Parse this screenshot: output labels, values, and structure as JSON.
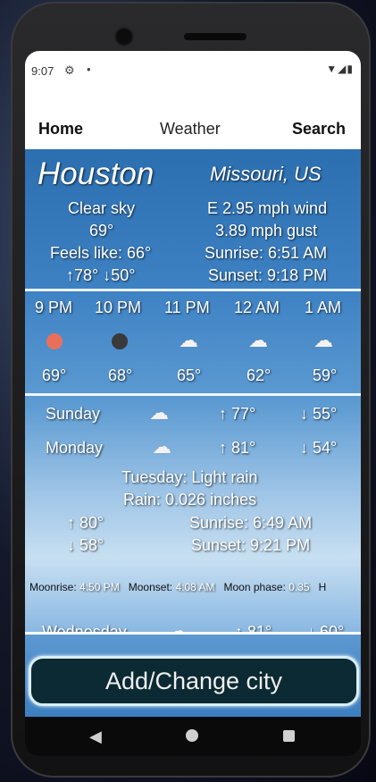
{
  "status": {
    "time": "9:07"
  },
  "nav": {
    "home": "Home",
    "weather": "Weather",
    "search": "Search"
  },
  "current": {
    "city": "Houston",
    "region": "Missouri, US",
    "condition": "Clear sky",
    "temp": "69°",
    "feels_like": "Feels like: 66°",
    "hi_lo": "↑78° ↓50°",
    "wind": "E 2.95 mph wind",
    "gust": "3.89 mph gust",
    "sunrise": "Sunrise: 6:51 AM",
    "sunset": "Sunset: 9:18 PM"
  },
  "hourly": [
    {
      "time": "9 PM",
      "icon": "sun-icon",
      "temp": "69°"
    },
    {
      "time": "10 PM",
      "icon": "moon-icon",
      "temp": "68°"
    },
    {
      "time": "11 PM",
      "icon": "partly-cloudy-night-icon",
      "temp": "65°"
    },
    {
      "time": "12 AM",
      "icon": "partly-cloudy-night-icon",
      "temp": "62°"
    },
    {
      "time": "1 AM",
      "icon": "partly-cloudy-night-icon",
      "temp": "59°"
    }
  ],
  "daily": [
    {
      "day": "Sunday",
      "icon": "partly-cloudy-day-icon",
      "high": "↑ 77°",
      "low": "↓ 55°"
    },
    {
      "day": "Monday",
      "icon": "partly-cloudy-day-icon",
      "high": "↑ 81°",
      "low": "↓ 54°"
    }
  ],
  "tuesday": {
    "summary": "Tuesday: Light rain",
    "rain": "Rain: 0.026 inches",
    "high": "↑ 80°",
    "low": "↓ 58°",
    "sunrise": "Sunrise: 6:49 AM",
    "sunset": "Sunset: 9:21 PM",
    "moonrise_label": "Moonrise:",
    "moonrise": "4:50 PM",
    "moonset_label": "Moonset:",
    "moonset": "4:08 AM",
    "moon_phase_label": "Moon phase:",
    "moon_phase": "0.35",
    "trailing": "H"
  },
  "wednesday": {
    "day": "Wednesday",
    "high": "↑ 81°",
    "low": "↓ 60°"
  },
  "add_button": "Add/Change city"
}
